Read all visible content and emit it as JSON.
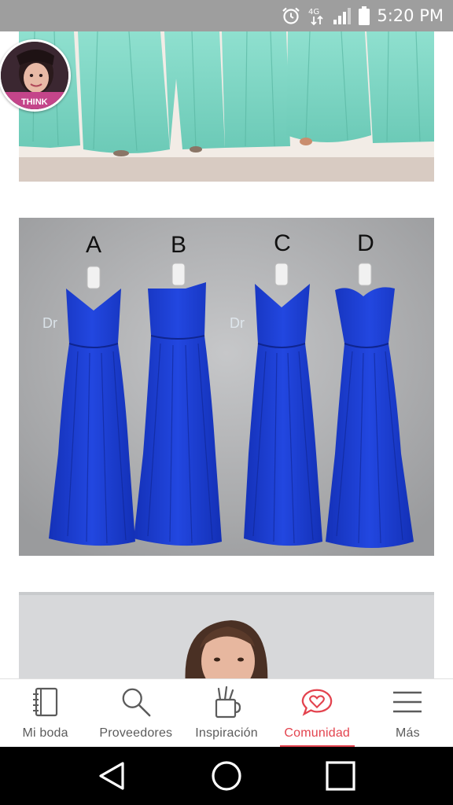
{
  "status_bar": {
    "time": "5:20 PM",
    "icons": [
      "alarm-icon",
      "data-4g-icon",
      "signal-icon",
      "battery-icon"
    ]
  },
  "feed": {
    "avatar_text": "THINK",
    "photos": [
      {
        "name": "mint-dresses-photo",
        "description_icon": "image"
      },
      {
        "name": "royal-blue-dresses-photo",
        "labels": [
          "A",
          "B",
          "C",
          "D"
        ]
      },
      {
        "name": "portrait-photo"
      }
    ]
  },
  "bottom_nav": {
    "items": [
      {
        "label": "Mi boda",
        "icon": "notebook-icon"
      },
      {
        "label": "Proveedores",
        "icon": "search-icon"
      },
      {
        "label": "Inspiración",
        "icon": "pencil-cup-icon"
      },
      {
        "label": "Comunidad",
        "icon": "chat-heart-icon",
        "active": true
      },
      {
        "label": "Más",
        "icon": "menu-icon"
      }
    ]
  },
  "colors": {
    "accent": "#e3434e",
    "mint": "#7fd6c4",
    "royal_blue": "#1b3fd0",
    "backdrop_gray": "#a9aaac"
  }
}
